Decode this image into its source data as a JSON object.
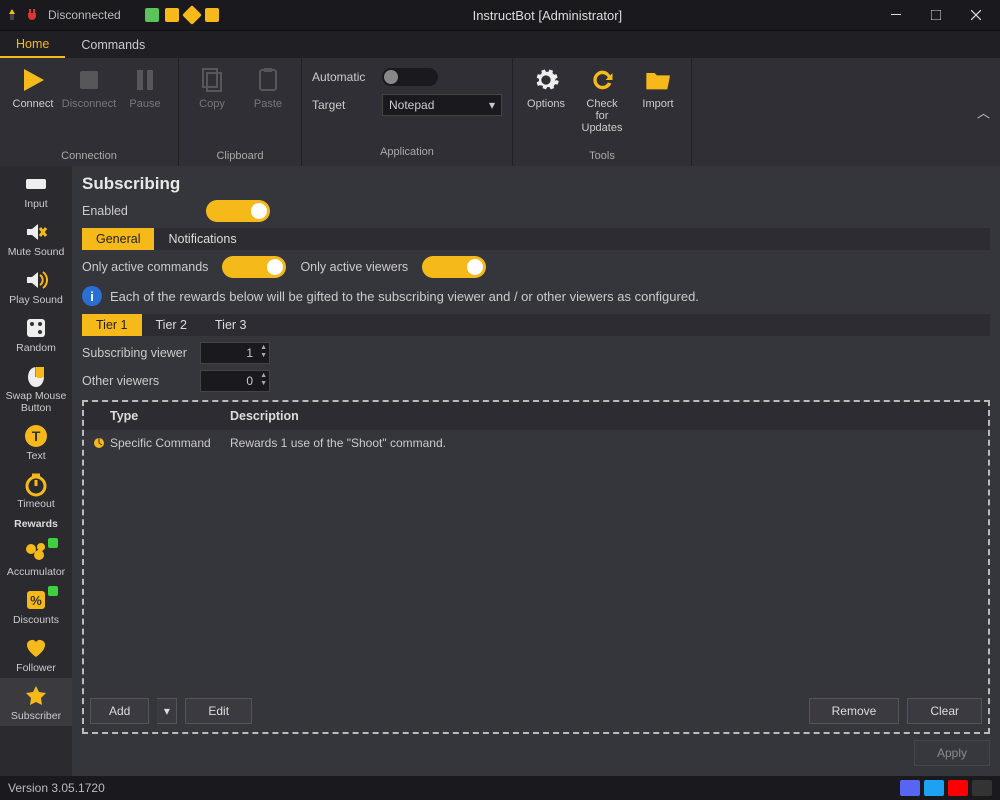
{
  "titlebar": {
    "status": "Disconnected",
    "title": "InstructBot [Administrator]",
    "badgeColors": [
      "#5ac35a",
      "#f5b91a",
      "#f5b91a",
      "#f5b91a"
    ]
  },
  "menu": {
    "items": [
      "Home",
      "Commands"
    ],
    "activeIndex": 0
  },
  "ribbon": {
    "connection": {
      "label": "Connection",
      "connect": "Connect",
      "disconnect": "Disconnect",
      "pause": "Pause"
    },
    "clipboard": {
      "label": "Clipboard",
      "copy": "Copy",
      "paste": "Paste"
    },
    "application": {
      "label": "Application",
      "automatic": "Automatic",
      "target": "Target",
      "targetValue": "Notepad"
    },
    "tools": {
      "label": "Tools",
      "options": "Options",
      "check": "Check for Updates",
      "import": "Import"
    }
  },
  "sidebar": {
    "items": [
      {
        "label": "Input"
      },
      {
        "label": "Mute Sound"
      },
      {
        "label": "Play Sound"
      },
      {
        "label": "Random"
      },
      {
        "label": "Swap Mouse Button"
      },
      {
        "label": "Text"
      },
      {
        "label": "Timeout"
      },
      {
        "label": "Rewards",
        "bold": true
      },
      {
        "label": "Accumulator",
        "dot": true
      },
      {
        "label": "Discounts",
        "dot": true
      },
      {
        "label": "Follower"
      },
      {
        "label": "Subscriber",
        "selected": true
      }
    ]
  },
  "page": {
    "title": "Subscribing",
    "enabled": "Enabled",
    "tabs": [
      "General",
      "Notifications"
    ],
    "activeTab": 0,
    "onlyActiveCommands": "Only active commands",
    "onlyActiveViewers": "Only active viewers",
    "info": "Each of the rewards below will be gifted to the subscribing viewer and / or other viewers as configured.",
    "tierTabs": [
      "Tier 1",
      "Tier 2",
      "Tier 3"
    ],
    "activeTier": 0,
    "subscribingViewerLabel": "Subscribing viewer",
    "subscribingViewerValue": "1",
    "otherViewersLabel": "Other viewers",
    "otherViewersValue": "0",
    "table": {
      "headers": [
        "Type",
        "Description"
      ],
      "rows": [
        {
          "type": "Specific Command",
          "description": "Rewards 1 use of the \"Shoot\" command."
        }
      ]
    },
    "buttons": {
      "add": "Add",
      "edit": "Edit",
      "remove": "Remove",
      "clear": "Clear",
      "apply": "Apply"
    }
  },
  "statusbar": {
    "version": "Version 3.05.1720"
  }
}
